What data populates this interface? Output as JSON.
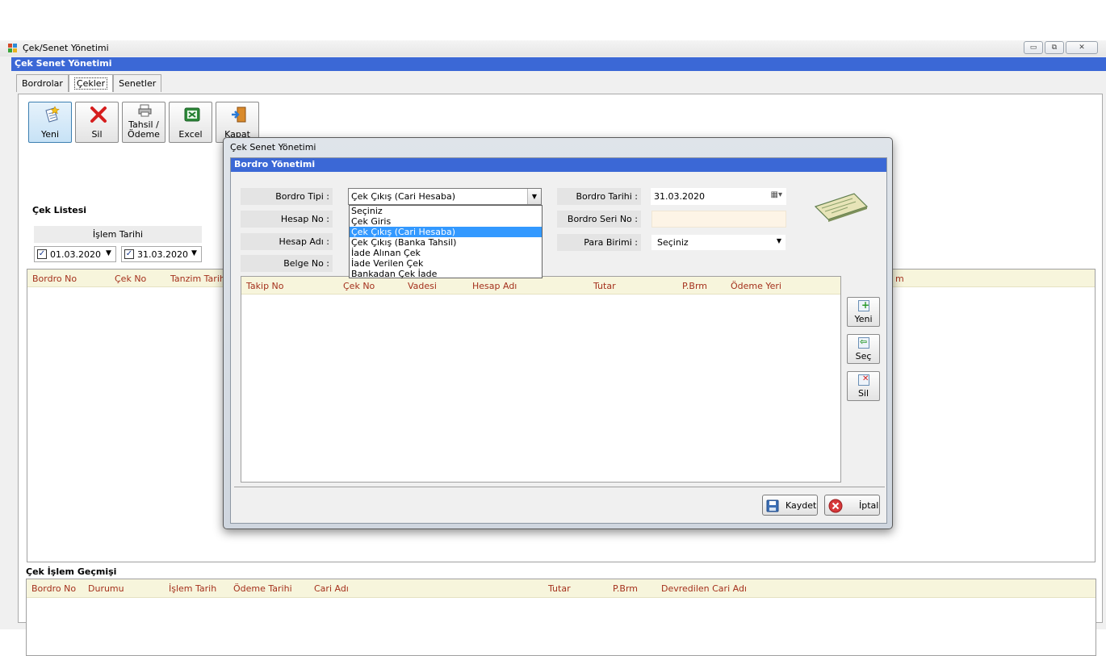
{
  "window": {
    "title": "Çek/Senet Yönetimi",
    "header": "Çek Senet Yönetimi"
  },
  "tabs": [
    {
      "label": "Bordrolar"
    },
    {
      "label": "Çekler"
    },
    {
      "label": "Senetler"
    }
  ],
  "toolbar": {
    "new_label": "Yeni",
    "delete_label": "Sil",
    "collect_label_1": "Tahsil /",
    "collect_label_2": "Ödeme",
    "excel_label": "Excel",
    "close_label": "Kapat"
  },
  "check_list": {
    "title": "Çek Listesi",
    "date_header": "İşlem Tarihi",
    "date_from": "01.03.2020",
    "date_to": "31.03.2020",
    "columns": [
      "Bordro No",
      "Çek No",
      "Tanzim Tarih"
    ],
    "right_col_fragment": "m"
  },
  "history": {
    "title": "Çek İşlem Geçmişi",
    "columns": [
      "Bordro No",
      "Durumu",
      "İşlem Tarih",
      "Ödeme Tarihi",
      "Cari Adı",
      "Tutar",
      "P.Brm",
      "Devredilen Cari Adı"
    ]
  },
  "dialog": {
    "title": "Çek Senet Yönetimi",
    "header": "Bordro Yönetimi",
    "labels": {
      "bordro_tipi": "Bordro Tipi :",
      "hesap_no": "Hesap No :",
      "hesap_adi": "Hesap Adı :",
      "belge_no": "Belge No :",
      "bordro_tarihi": "Bordro Tarihi :",
      "bordro_seri_no": "Bordro Seri No :",
      "para_birimi": "Para Birimi :"
    },
    "bordro_tipi_value": "Çek Çıkış (Cari Hesaba)",
    "bordro_tarihi_value": "31.03.2020",
    "para_birimi_value": "Seçiniz",
    "dropdown_options": [
      "Seçiniz",
      "Çek Giris",
      "Çek Çıkış (Cari Hesaba)",
      "Çek Çıkış (Banka Tahsil)",
      "İade Alınan Çek",
      "İade Verilen Çek",
      "Bankadan Çek İade"
    ],
    "selected_index": 2,
    "grid_columns": [
      "Takip No",
      "Çek No",
      "Vadesi",
      "Hesap Adı",
      "Tutar",
      "P.Brm",
      "Ödeme Yeri"
    ],
    "side_buttons": {
      "new": "Yeni",
      "select": "Seç",
      "delete": "Sil"
    },
    "save_label": "Kaydet",
    "cancel_label": "İptal"
  },
  "colors": {
    "header_blue": "#3b68d6",
    "grid_header_bg": "#f7f5dc",
    "grid_header_text": "#a4301c",
    "selection": "#3399ff"
  }
}
